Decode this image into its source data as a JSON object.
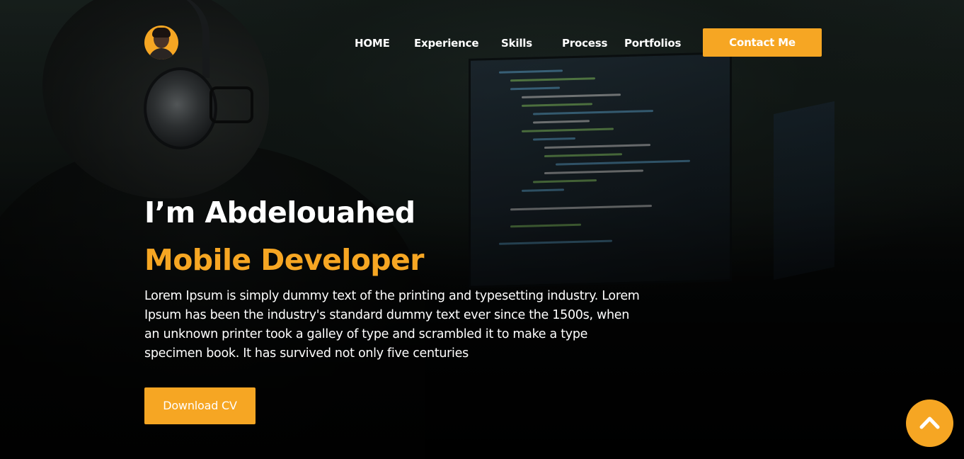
{
  "header": {
    "avatar_alt": "profile avatar",
    "nav": [
      {
        "label": "HOME"
      },
      {
        "label": "Experience"
      },
      {
        "label": "Skills"
      },
      {
        "label": "Process"
      },
      {
        "label": "Portfolios"
      }
    ],
    "contact_label": "Contact Me"
  },
  "hero": {
    "title": "I’m Abdelouahed",
    "role": "Mobile Developer",
    "description": "Lorem Ipsum is simply dummy text of the printing and typesetting industry. Lorem Ipsum has been the industry's standard dummy text ever since the 1500s, when an unknown printer took a galley of type and scrambled it to make a type specimen book. It has survived not only five centuries",
    "cta_label": "Download CV"
  },
  "scroll_top": {
    "icon": "chevron-up-icon"
  },
  "colors": {
    "accent": "#f6a623",
    "text": "#ffffff",
    "background": "#050606"
  }
}
